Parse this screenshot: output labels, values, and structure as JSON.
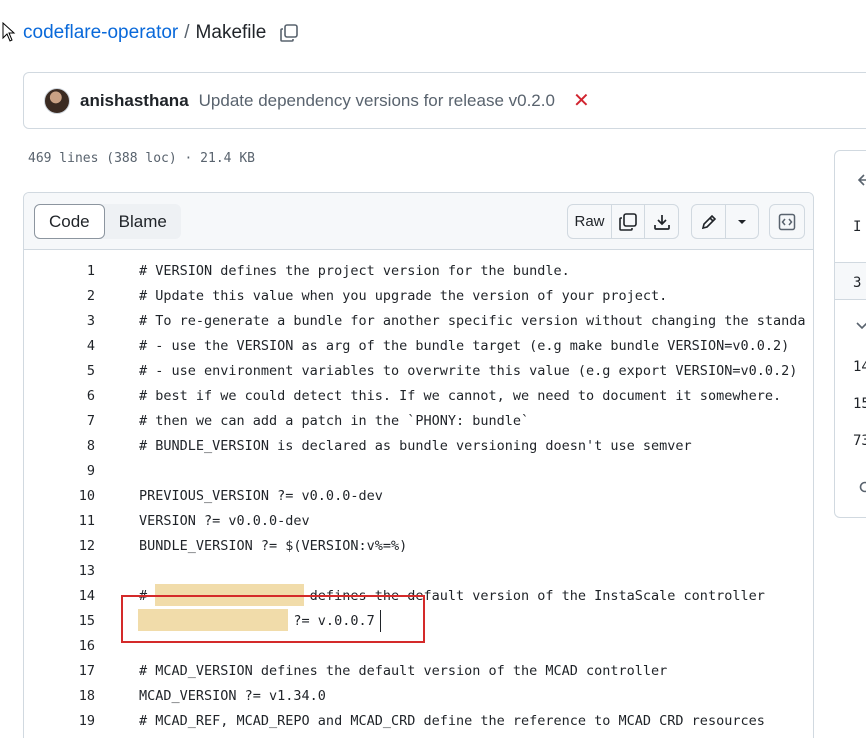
{
  "breadcrumb": {
    "repo": "codeflare-operator",
    "separator": "/",
    "file": "Makefile"
  },
  "commit": {
    "author": "anishasthana",
    "message": "Update dependency versions for release v0.2.0",
    "status_icon": "x-icon",
    "status_color": "#d1242f"
  },
  "file_meta": "469 lines (388 loc) · 21.4 KB",
  "toolbar": {
    "tab_code": "Code",
    "tab_blame": "Blame",
    "raw": "Raw"
  },
  "side_panel": {
    "items": [
      "I",
      "3",
      "14",
      "15",
      "73"
    ]
  },
  "code_lines": [
    {
      "n": "1",
      "t": "# VERSION defines the project version for the bundle."
    },
    {
      "n": "2",
      "t": "# Update this value when you upgrade the version of your project."
    },
    {
      "n": "3",
      "t": "# To re-generate a bundle for another specific version without changing the standa"
    },
    {
      "n": "4",
      "t": "# - use the VERSION as arg of the bundle target (e.g make bundle VERSION=v0.0.2)"
    },
    {
      "n": "5",
      "t": "# - use environment variables to overwrite this value (e.g export VERSION=v0.0.2)"
    },
    {
      "n": "6",
      "t": "# best if we could detect this. If we cannot, we need to document it somewhere."
    },
    {
      "n": "7",
      "t": "# then we can add a patch in the `PHONY: bundle`"
    },
    {
      "n": "8",
      "t": "# BUNDLE_VERSION is declared as bundle versioning doesn't use semver"
    },
    {
      "n": "9",
      "t": ""
    },
    {
      "n": "10",
      "t": "PREVIOUS_VERSION ?= v0.0.0-dev"
    },
    {
      "n": "11",
      "t": "VERSION ?= v0.0.0-dev"
    },
    {
      "n": "12",
      "t": "BUNDLE_VERSION ?= $(VERSION:v%=%)"
    },
    {
      "n": "13",
      "t": ""
    },
    {
      "n": "14",
      "t": "# INSTASCALE_VERSION defines the default version of the InstaScale controller"
    },
    {
      "n": "15",
      "t": "INSTASCALE_VERSION ?= v.0.0.7"
    },
    {
      "n": "16",
      "t": ""
    },
    {
      "n": "17",
      "t": "# MCAD_VERSION defines the default version of the MCAD controller"
    },
    {
      "n": "18",
      "t": "MCAD_VERSION ?= v1.34.0"
    },
    {
      "n": "19",
      "t": "# MCAD_REF, MCAD_REPO and MCAD_CRD define the reference to MCAD CRD resources"
    }
  ]
}
